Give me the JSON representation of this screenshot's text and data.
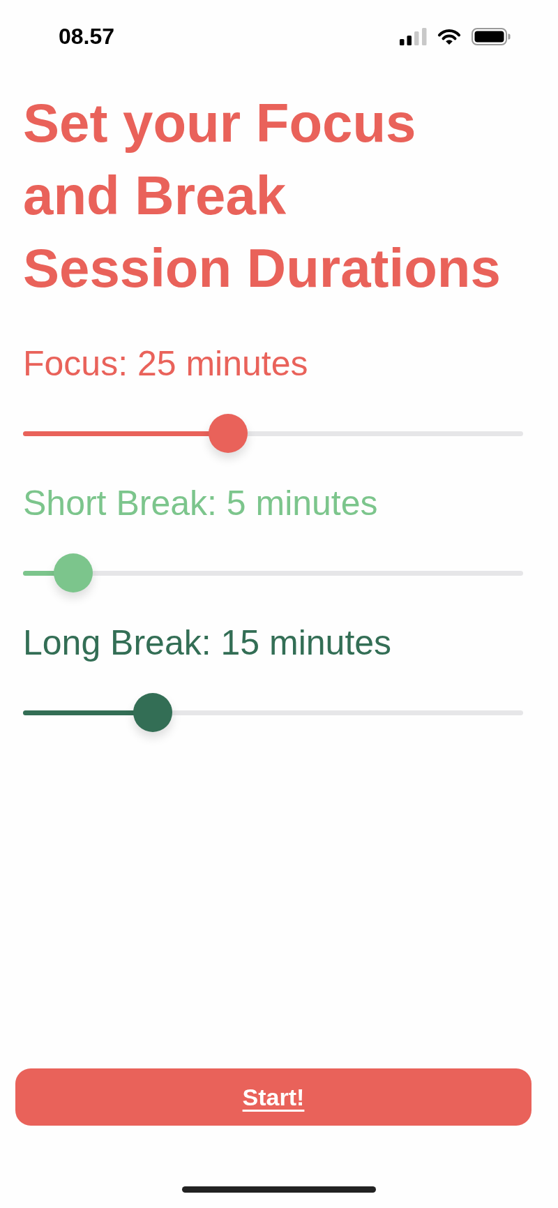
{
  "status_bar": {
    "time": "08.57"
  },
  "title_lines": [
    "Set your Focus",
    "and Break",
    "Session Durations"
  ],
  "sliders": [
    {
      "label": "Focus: 25 minutes",
      "color": "#e9625a",
      "level": 0.41
    },
    {
      "label": "Short Break: 5 minutes",
      "color": "#7cc58c",
      "level": 0.1
    },
    {
      "label": "Long Break: 15 minutes",
      "color": "#336e55",
      "level": 0.26
    }
  ],
  "start_button": {
    "label": "Start!"
  }
}
